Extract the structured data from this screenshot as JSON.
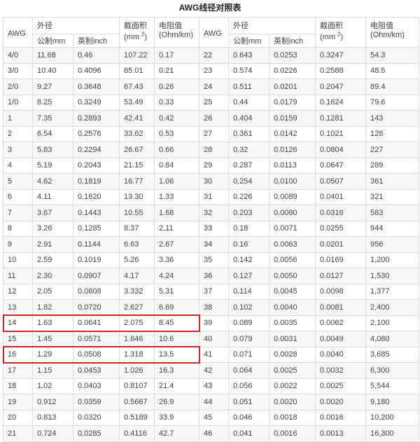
{
  "title": "AWG线径对照表",
  "headers": {
    "awg": "AWG",
    "outer_diameter": "外径",
    "mm": "公制mm",
    "inch": "英制inch",
    "area": "截面积",
    "area_unit": "(mm 2)",
    "resistance": "电阻值",
    "resistance_unit": "(Ohm/km)"
  },
  "highlight_color": "#c8262b",
  "left_rows": [
    [
      "4/0",
      "11.68",
      "0.46",
      "107.22",
      "0.17"
    ],
    [
      "3/0",
      "10.40",
      "0.4096",
      "85.01",
      "0.21"
    ],
    [
      "2/0",
      "9.27",
      "0.3648",
      "67.43",
      "0.26"
    ],
    [
      "1/0",
      "8.25",
      "0.3249",
      "53.49",
      "0.33"
    ],
    [
      "1",
      "7.35",
      "0.2893",
      "42.41",
      "0.42"
    ],
    [
      "2",
      "6.54",
      "0.2576",
      "33.62",
      "0.53"
    ],
    [
      "3",
      "5.83",
      "0.2294",
      "26.67",
      "0.66"
    ],
    [
      "4",
      "5.19",
      "0.2043",
      "21.15",
      "0.84"
    ],
    [
      "5",
      "4.62",
      "0.1819",
      "16.77",
      "1.06"
    ],
    [
      "6",
      "4.11",
      "0.1620",
      "13.30",
      "1.33"
    ],
    [
      "7",
      "3.67",
      "0.1443",
      "10.55",
      "1.68"
    ],
    [
      "8",
      "3.26",
      "0.1285",
      "8.37",
      "2.11"
    ],
    [
      "9",
      "2.91",
      "0.1144",
      "6.63",
      "2.67"
    ],
    [
      "10",
      "2.59",
      "0.1019",
      "5.26",
      "3.36"
    ],
    [
      "11",
      "2.30",
      "0.0907",
      "4.17",
      "4.24"
    ],
    [
      "12",
      "2.05",
      "0.0808",
      "3.332",
      "5.31"
    ],
    [
      "13",
      "1.82",
      "0.0720",
      "2.627",
      "6.69"
    ],
    [
      "14",
      "1.63",
      "0.0641",
      "2.075",
      "8.45"
    ],
    [
      "15",
      "1.45",
      "0.0571",
      "1.646",
      "10.6"
    ],
    [
      "16",
      "1.29",
      "0.0508",
      "1.318",
      "13.5"
    ],
    [
      "17",
      "1.15",
      "0.0453",
      "1.026",
      "16.3"
    ],
    [
      "18",
      "1.02",
      "0.0403",
      "0.8107",
      "21.4"
    ],
    [
      "19",
      "0.912",
      "0.0359",
      "0.5667",
      "26.9"
    ],
    [
      "20",
      "0.813",
      "0.0320",
      "0.5189",
      "33.9"
    ],
    [
      "21",
      "0.724",
      "0.0285",
      "0.4116",
      "42.7"
    ]
  ],
  "right_rows": [
    [
      "22",
      "0.643",
      "0.0253",
      "0.3247",
      "54.3"
    ],
    [
      "23",
      "0.574",
      "0.0226",
      "0.2588",
      "48.5"
    ],
    [
      "24",
      "0.511",
      "0.0201",
      "0.2047",
      "89.4"
    ],
    [
      "25",
      "0.44",
      "0.0179",
      "0.1624",
      "79.6"
    ],
    [
      "26",
      "0.404",
      "0.0159",
      "0.1281",
      "143"
    ],
    [
      "27",
      "0.361",
      "0.0142",
      "0.1021",
      "128"
    ],
    [
      "28",
      "0.32",
      "0.0126",
      "0.0804",
      "227"
    ],
    [
      "29",
      "0.287",
      "0.0113",
      "0.0647",
      "289"
    ],
    [
      "30",
      "0.254",
      "0.0100",
      "0.0507",
      "361"
    ],
    [
      "31",
      "0.226",
      "0.0089",
      "0.0401",
      "321"
    ],
    [
      "32",
      "0.203",
      "0.0080",
      "0.0316",
      "583"
    ],
    [
      "33",
      "0.18",
      "0.0071",
      "0.0255",
      "944"
    ],
    [
      "34",
      "0.16",
      "0.0063",
      "0.0201",
      "956"
    ],
    [
      "35",
      "0.142",
      "0.0056",
      "0.0169",
      "1,200"
    ],
    [
      "36",
      "0.127",
      "0.0050",
      "0.0127",
      "1,530"
    ],
    [
      "37",
      "0.114",
      "0.0045",
      "0.0098",
      "1,377"
    ],
    [
      "38",
      "0.102",
      "0.0040",
      "0.0081",
      "2,400"
    ],
    [
      "39",
      "0.089",
      "0.0035",
      "0.0062",
      "2,100"
    ],
    [
      "40",
      "0.079",
      "0.0031",
      "0.0049",
      "4,080"
    ],
    [
      "41",
      "0.071",
      "0.0028",
      "0.0040",
      "3,685"
    ],
    [
      "42",
      "0.064",
      "0.0025",
      "0.0032",
      "6,300"
    ],
    [
      "43",
      "0.056",
      "0.0022",
      "0.0025",
      "5,544"
    ],
    [
      "44",
      "0.051",
      "0.0020",
      "0.0020",
      "9,180"
    ],
    [
      "45",
      "0.046",
      "0.0018",
      "0.0016",
      "10,200"
    ],
    [
      "46",
      "0.041",
      "0.0016",
      "0.0013",
      "16,300"
    ]
  ]
}
